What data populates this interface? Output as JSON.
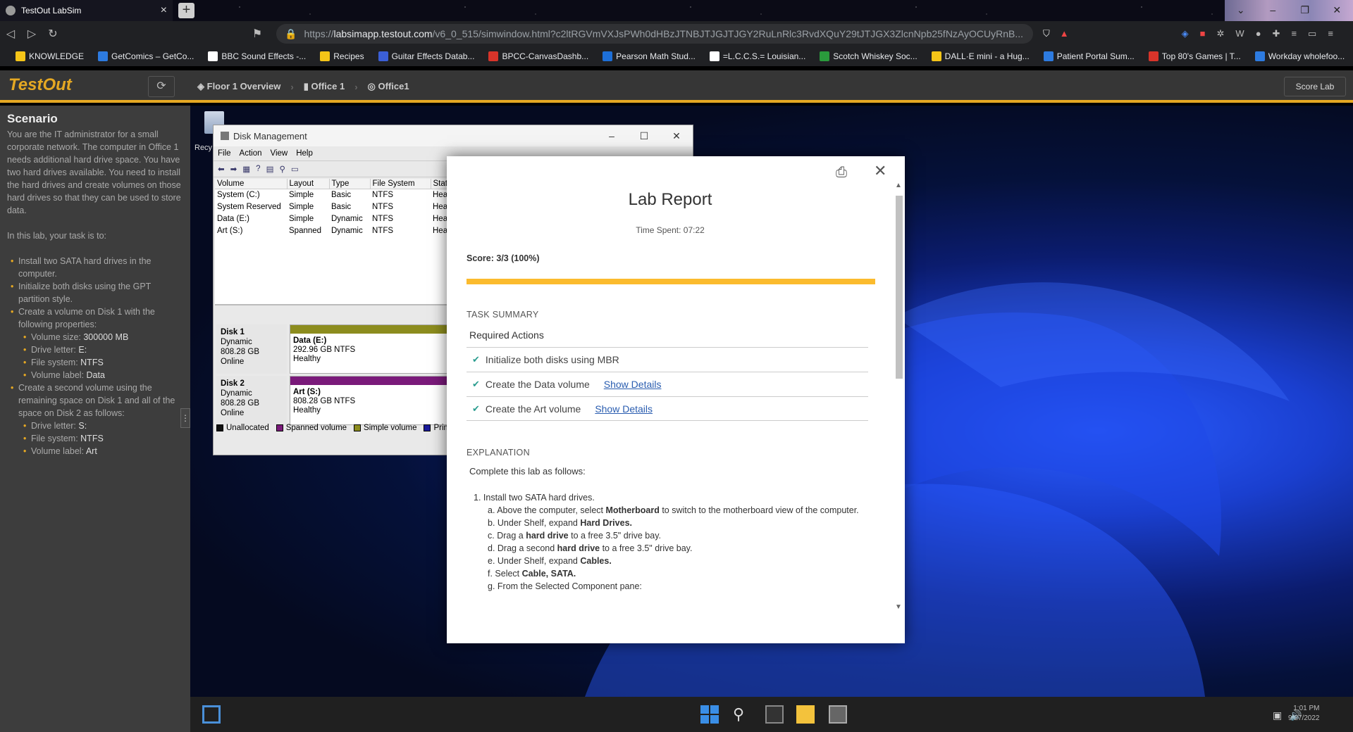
{
  "browser": {
    "tab_title": "TestOut LabSim",
    "url_prefix": "https://",
    "url_host": "labsimapp.testout.com",
    "url_path": "/v6_0_515/simwindow.html?c2ltRGVmVXJsPWh0dHBzJTNBJTJGJTJGY2RuLnRlc3RvdXQuY29tJTJGX3ZlcnNpb25fNzAyOCUyRnB...",
    "bookmarks": [
      {
        "label": "KNOWLEDGE",
        "color": "#f5c518"
      },
      {
        "label": "GetComics – GetCo...",
        "color": "#2d7be0"
      },
      {
        "label": "BBC Sound Effects -...",
        "color": "#ffffff"
      },
      {
        "label": "Recipes",
        "color": "#f5c518"
      },
      {
        "label": "Guitar Effects Datab...",
        "color": "#3b5fd6"
      },
      {
        "label": "BPCC-CanvasDashb...",
        "color": "#d8342a"
      },
      {
        "label": "Pearson Math Stud...",
        "color": "#1d6fd8"
      },
      {
        "label": "=L.C.C.S.= Louisian...",
        "color": "#ffffff"
      },
      {
        "label": "Scotch Whiskey Soc...",
        "color": "#2a9a3c"
      },
      {
        "label": "DALL·E mini - a Hug...",
        "color": "#f5c518"
      },
      {
        "label": "Patient Portal Sum...",
        "color": "#2d7be0"
      },
      {
        "label": "Top 80's Games | T...",
        "color": "#d8342a"
      },
      {
        "label": "Workday wholefoo...",
        "color": "#2d7be0"
      }
    ]
  },
  "app": {
    "logo": "TestOut",
    "breadcrumbs": [
      "Floor 1 Overview",
      "Office 1",
      "Office1"
    ],
    "score_lab": "Score Lab"
  },
  "scenario": {
    "heading": "Scenario",
    "intro": "You are the IT administrator for a small corporate network. The computer in Office 1 needs additional hard drive space. You have two hard drives available. You need to install the hard drives and create volumes on those hard drives so that they can be used to store data.",
    "task_intro": "In this lab, your task is to:",
    "t1": "Install two SATA hard drives in the computer.",
    "t2": "Initialize both disks using the GPT partition style.",
    "t3": "Create a volume on Disk 1 with the following properties:",
    "t3a_label": "Volume size: ",
    "t3a_val": "300000 MB",
    "t3b_label": "Drive letter: ",
    "t3b_val": "E:",
    "t3c_label": "File system: ",
    "t3c_val": "NTFS",
    "t3d_label": "Volume label: ",
    "t3d_val": "Data",
    "t4": "Create a second volume using the remaining space on Disk 1 and all of the space on Disk 2 as follows:",
    "t4a_label": "Drive letter: ",
    "t4a_val": "S:",
    "t4b_label": "File system: ",
    "t4b_val": "NTFS",
    "t4c_label": "Volume label: ",
    "t4c_val": "Art"
  },
  "desktop": {
    "recycle_label": "Recy"
  },
  "disk_mgmt": {
    "title": "Disk Management",
    "menu": [
      "File",
      "Action",
      "View",
      "Help"
    ],
    "columns": [
      "Volume",
      "Layout",
      "Type",
      "File System",
      "Stat"
    ],
    "rows": [
      [
        "System (C:)",
        "Simple",
        "Basic",
        "NTFS",
        "Hea"
      ],
      [
        "System Reserved",
        "Simple",
        "Basic",
        "NTFS",
        "Hea"
      ],
      [
        "Data (E:)",
        "Simple",
        "Dynamic",
        "NTFS",
        "Hea"
      ],
      [
        "Art (S:)",
        "Spanned",
        "Dynamic",
        "NTFS",
        "Hea"
      ]
    ],
    "disk1": {
      "name": "Disk 1",
      "type": "Dynamic",
      "size": "808.28 GB",
      "status": "Online",
      "part_name": "Data (E:)",
      "part_size": "292.96 GB NTFS",
      "part_status": "Healthy",
      "color": "#8c8c1e"
    },
    "disk2": {
      "name": "Disk 2",
      "type": "Dynamic",
      "size": "808.28 GB",
      "status": "Online",
      "part_name": "Art (S:)",
      "part_size": "808.28 GB NTFS",
      "part_status": "Healthy",
      "color": "#7a1a7a"
    },
    "legend": [
      {
        "label": "Unallocated",
        "color": "#111111"
      },
      {
        "label": "Spanned volume",
        "color": "#7a1a7a"
      },
      {
        "label": "Simple volume",
        "color": "#8c8c1e"
      },
      {
        "label": "Prima",
        "color": "#1a1a9a"
      }
    ]
  },
  "report": {
    "title": "Lab Report",
    "time_spent": "Time Spent: 07:22",
    "score": "Score: 3/3 (100%)",
    "score_fraction": 1.0,
    "task_summary": "TASK SUMMARY",
    "required_actions": "Required Actions",
    "tasks": [
      {
        "label": "Initialize both disks using MBR",
        "link": ""
      },
      {
        "label": "Create the Data volume",
        "link": "Show Details"
      },
      {
        "label": "Create the Art volume",
        "link": "Show Details"
      }
    ],
    "explanation": "EXPLANATION",
    "intro": "Complete this lab as follows:",
    "step1": "1. Install two SATA hard drives.",
    "a_pre": "a. Above the computer, select ",
    "a_b": "Motherboard",
    "a_post": " to switch to the motherboard view of the computer.",
    "b_pre": "b. Under Shelf, expand ",
    "b_b": "Hard Drives.",
    "c_pre": "c. Drag a ",
    "c_b": "hard drive",
    "c_post": " to a free 3.5\" drive bay.",
    "d_pre": "d. Drag a second ",
    "d_b": "hard drive",
    "d_post": " to a free 3.5\" drive bay.",
    "e_pre": "e. Under Shelf, expand ",
    "e_b": "Cables.",
    "f_pre": "f. Select ",
    "f_b": "Cable, SATA.",
    "g": "g. From the Selected Component pane:"
  },
  "taskbar": {
    "time": "1:01 PM",
    "date": "9/27/2022"
  }
}
